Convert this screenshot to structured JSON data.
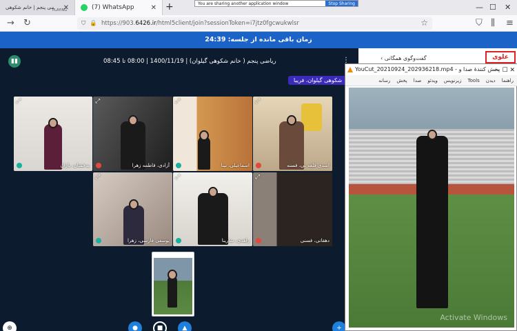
{
  "browser": {
    "tab1": {
      "title": "کلاس ریاضی پنجم | خانم شکوهی",
      "audio": "PLAYING"
    },
    "tab2": {
      "title": "(7) WhatsApp"
    },
    "share_notice": "You are sharing another application window",
    "share_stop": "Stop Sharing",
    "url_prefix": "https://903.",
    "url_domain": "6426.ir",
    "url_rest": "/html5client/join?sessionToken=i7jtz0fgcwukwlsr"
  },
  "meeting": {
    "remaining": "زمان باقی مانده از جلسه: 24:39",
    "session_title": "ریاضی پنجم ( خانم شکوهی گیلوان) | 1400/11/19 | 08:00 تا 08:45",
    "presenter_label": "شکوهی گیلوان، فریبا",
    "tiles": [
      {
        "name": "بدخشان، یاران",
        "mic": "on"
      },
      {
        "name": "آزادی، فاطمه زهرا",
        "mic": "off"
      },
      {
        "name": "اسماعیلی، نینا",
        "mic": "on"
      },
      {
        "name": "اسدی قلعه نی، فسنه",
        "mic": "off"
      },
      {
        "name": "یوسفی فارسی، زهرا",
        "mic": "on"
      },
      {
        "name": "زاهدی، سارینا",
        "mic": "on"
      },
      {
        "name": "دهقانی، فسنی",
        "mic": "off"
      }
    ]
  },
  "right_page": {
    "chat_header": "گفت‌وگوی همگانی",
    "logo_text": "علوی"
  },
  "player": {
    "title": "YouCut_20210924_202936218.mp4 - پخش کنندهٔ صدا و",
    "menu": [
      "راهنما",
      "دیدن",
      "Tools",
      "زیرنویس",
      "ویدئو",
      "صدا",
      "پخش",
      "رسانه"
    ],
    "watermark": "Activate Windows"
  }
}
